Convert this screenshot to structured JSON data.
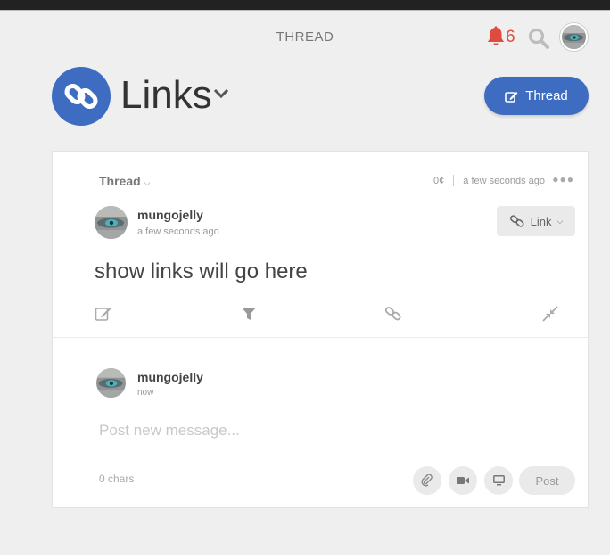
{
  "header": {
    "title": "THREAD",
    "notification_count": "6",
    "bell_color": "#e04b3f"
  },
  "channel": {
    "name": "Links",
    "icon": "link-icon",
    "accent": "#3d6cc1"
  },
  "new_thread_button": {
    "label": "Thread",
    "icon": "edit-icon"
  },
  "post": {
    "type_label": "Thread",
    "cost": "0¢",
    "meta_time": "a few seconds ago",
    "author": "mungojelly",
    "time": "a few seconds ago",
    "link_button_label": "Link",
    "body": "show links will go here",
    "tools": [
      "edit-icon",
      "filter-icon",
      "link-icon",
      "compress-icon"
    ]
  },
  "composer": {
    "author": "mungojelly",
    "time": "now",
    "placeholder": "Post new message...",
    "char_count": "0 chars",
    "attach_icons": [
      "paperclip-icon",
      "video-icon",
      "monitor-icon"
    ],
    "post_label": "Post"
  }
}
